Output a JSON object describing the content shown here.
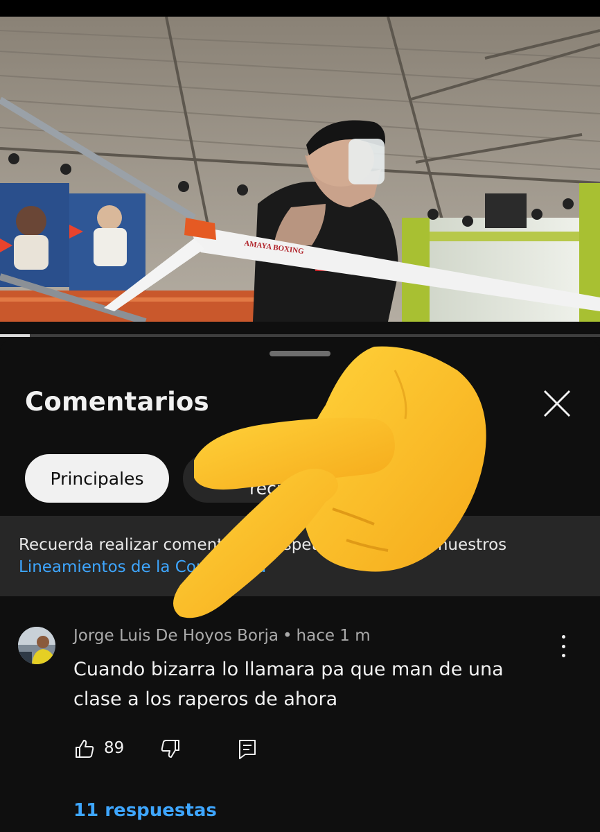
{
  "video": {
    "ring_rope_text": "AMAYA BOXING",
    "progress_fraction": 0.05
  },
  "panel": {
    "title": "Comentarios"
  },
  "chips": {
    "active": "Principales",
    "second": "Más recientes"
  },
  "notice": {
    "text": "Recuerda realizar comentarios respetuosos y seguir nuestros",
    "link": "Lineamientos de la Comunidad"
  },
  "comment": {
    "author": "Jorge Luis De Hoyos Borja",
    "separator": "•",
    "time": "hace 1 m",
    "text": "Cuando bizarra lo llamara pa que man de una clase a los raperos de ahora",
    "likes": "89",
    "replies_link": "11 respuestas"
  },
  "icons": {
    "close": "close-icon",
    "more": "more-vert-icon",
    "like": "thumb-up-icon",
    "dislike": "thumb-down-icon",
    "reply": "reply-icon",
    "overlay": "backhand-pointing-down-emoji"
  },
  "colors": {
    "background": "#0f0f0f",
    "surface": "#272727",
    "link": "#3ea6ff",
    "text": "#f1f1f1",
    "secondary_text": "#aaaaaa"
  }
}
